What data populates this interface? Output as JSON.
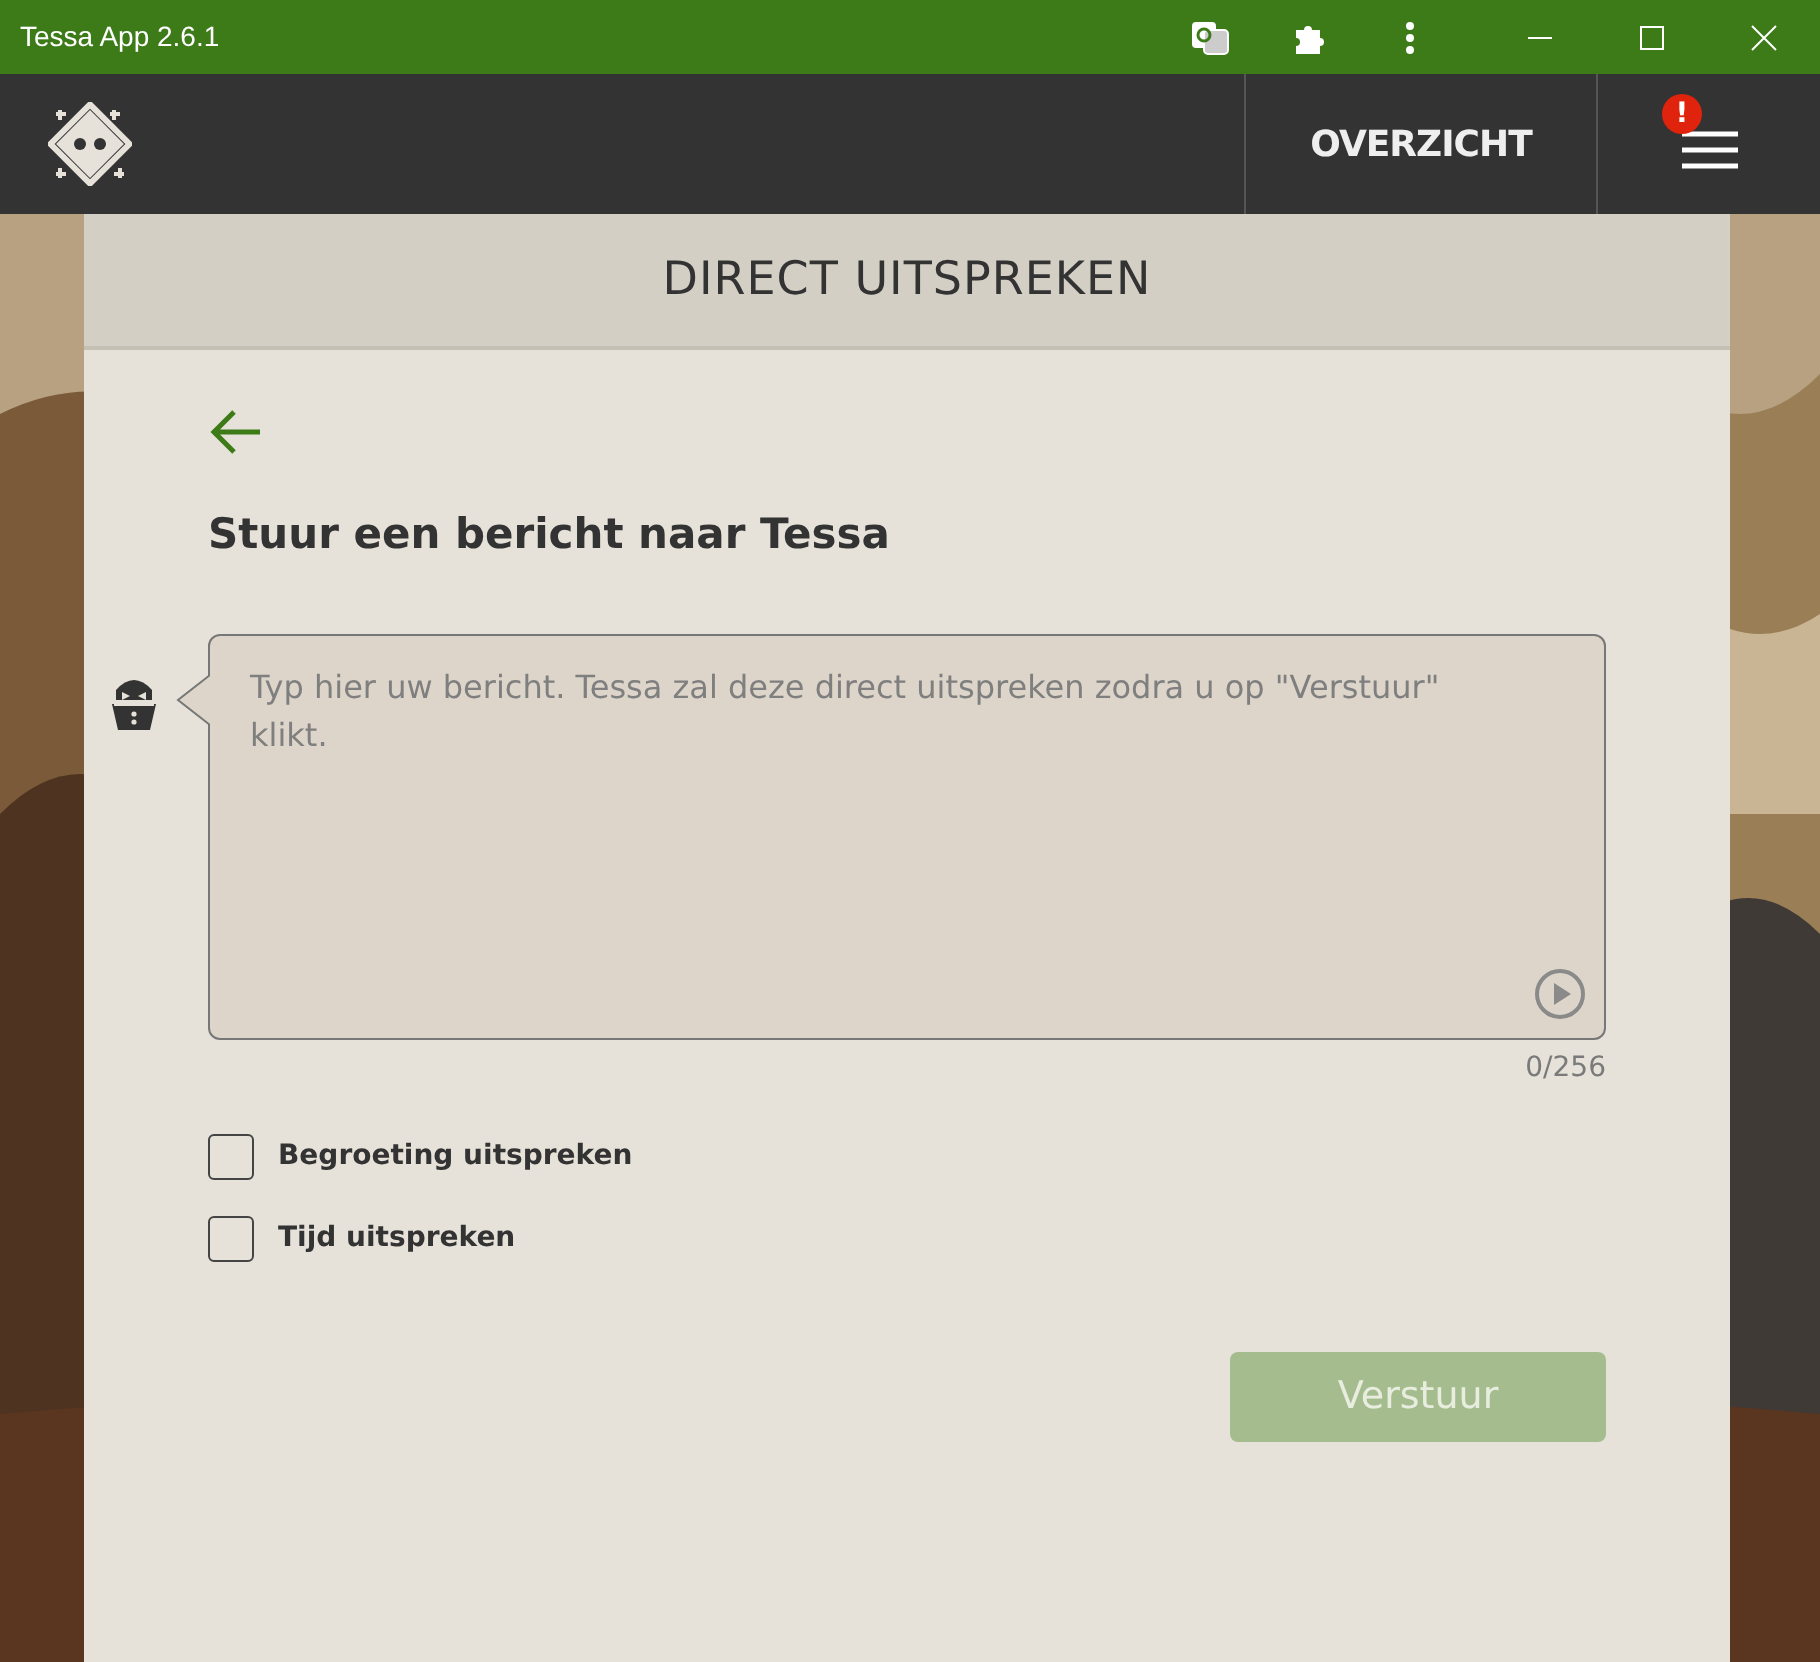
{
  "window": {
    "title": "Tessa App 2.6.1"
  },
  "nav": {
    "link": "OVERZICHT",
    "alert": "!"
  },
  "panel": {
    "title": "DIRECT UITSPREKEN",
    "heading": "Stuur een bericht naar Tessa",
    "message": {
      "placeholder": "Typ hier uw bericht. Tessa zal deze direct uitspreken zodra u op \"Verstuur\" klikt.",
      "counter": "0/256"
    },
    "options": [
      {
        "label": "Begroeting uitspreken",
        "checked": false
      },
      {
        "label": "Tijd uitspreken",
        "checked": false
      }
    ],
    "submit": {
      "label": "Verstuur",
      "disabled": true
    }
  }
}
